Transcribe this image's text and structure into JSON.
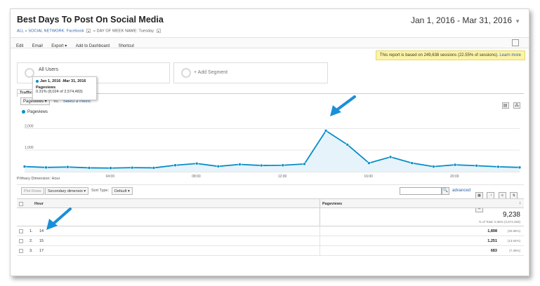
{
  "report": {
    "title": "Best Days To Post On Social Media",
    "date_range": "Jan 1, 2016 - Mar 31, 2016",
    "breadcrumb": {
      "all": "ALL",
      "sep1": "»",
      "network": "SOCIAL NETWORK: Facebook",
      "sep2": "»",
      "weekday": "DAY OF WEEK NAME: Tuesday"
    }
  },
  "toolbar": {
    "edit": "Edit",
    "email": "Email",
    "export": "Export ▾",
    "add_to_dashboard": "Add to Dashboard",
    "shortcut": "Shortcut"
  },
  "notice": {
    "text": "This report is based on 249,638 sessions (22.55% of sessions).",
    "link": "Learn more"
  },
  "segments": {
    "all_users": "All Users",
    "add_segment": "+ Add Segment"
  },
  "tooltip": {
    "date": "Jan 1, 2016 -Mar 31, 2016",
    "metric": "Pageviews",
    "value": "0.31% (8,024 of 2,574,483)"
  },
  "tabs": {
    "traffic": "Traffic"
  },
  "metric_picker": {
    "selected": "Pageviews ▾",
    "vs": "vs.",
    "select_metric": "Select a metric"
  },
  "chart_data": {
    "type": "line",
    "legend": "Pageviews",
    "x_ticks": [
      "...",
      "04:00",
      "08:00",
      "12:00",
      "16:00",
      "20:00"
    ],
    "y_ticks": [
      "2,000",
      "1,000"
    ],
    "ylim": [
      0,
      2400
    ],
    "x": [
      0,
      1,
      2,
      3,
      4,
      5,
      6,
      7,
      8,
      9,
      10,
      11,
      12,
      13,
      14,
      15,
      16,
      17,
      18,
      19,
      20,
      21,
      22,
      23
    ],
    "values": [
      240,
      200,
      220,
      180,
      170,
      190,
      180,
      300,
      380,
      250,
      340,
      290,
      300,
      360,
      1898,
      1251,
      400,
      683,
      400,
      240,
      320,
      280,
      230,
      200
    ]
  },
  "primary_dimension": "Primary Dimension: Hour",
  "table_toolbar": {
    "plot_rows": "Plot Rows",
    "secondary_dimension": "Secondary dimensio ▾",
    "sort_type_label": "Sort Type:",
    "sort_type_value": "Default ▾",
    "search_icon": "🔍",
    "advanced": "advanced"
  },
  "table": {
    "col_hour": "Hour",
    "col_pageviews": "Pageviews",
    "sort_arrow": "↓",
    "total_value": "9,238",
    "total_sub": "% of Total: 0.36% (2,574,483)",
    "rows": [
      {
        "rank": "1.",
        "hour": "14",
        "pageviews": "1,898",
        "pct": "(20.55%)"
      },
      {
        "rank": "2.",
        "hour": "15",
        "pageviews": "1,251",
        "pct": "(13.54%)"
      },
      {
        "rank": "3.",
        "hour": "17",
        "pageviews": "683",
        "pct": "(7.39%)"
      }
    ]
  },
  "colors": {
    "line": "#058dc7",
    "fill": "#e6f3fa",
    "annotation_arrow": "#1a8fd8"
  }
}
